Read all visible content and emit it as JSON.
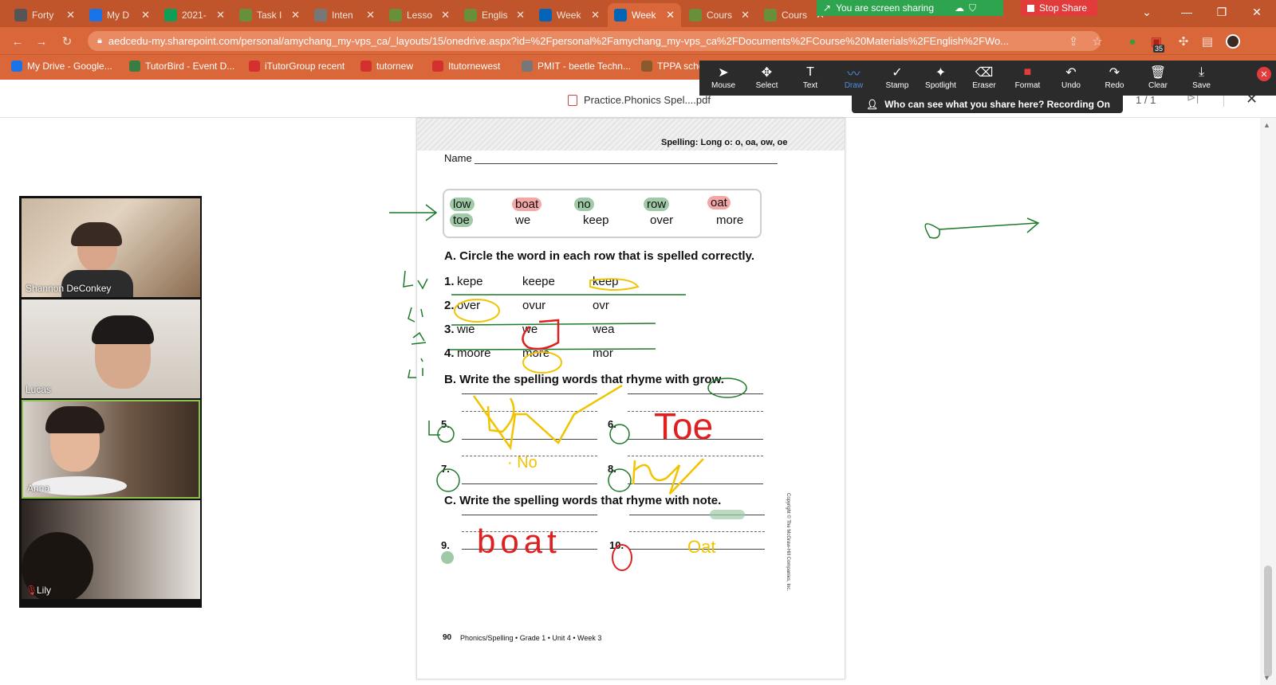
{
  "tabs": [
    {
      "title": "Forty",
      "icon": "gear-icon",
      "color": "#555555"
    },
    {
      "title": "My D",
      "icon": "drive-icon",
      "color": "#1a73e8"
    },
    {
      "title": "2021-",
      "icon": "sheets-icon",
      "color": "#0f9d58"
    },
    {
      "title": "Task I",
      "icon": "doc-icon",
      "color": "#6a8f3a"
    },
    {
      "title": "Inten",
      "icon": "globe-icon",
      "color": "#777777"
    },
    {
      "title": "Lesso",
      "icon": "doc-icon",
      "color": "#6a8f3a"
    },
    {
      "title": "Englis",
      "icon": "doc-icon",
      "color": "#6a8f3a"
    },
    {
      "title": "Week",
      "icon": "onedrive-icon",
      "color": "#0364b8"
    },
    {
      "title": "Week",
      "icon": "onedrive-icon",
      "color": "#0364b8"
    },
    {
      "title": "Cours",
      "icon": "doc-icon",
      "color": "#6a8f3a"
    },
    {
      "title": "Cours",
      "icon": "doc-icon",
      "color": "#6a8f3a"
    }
  ],
  "share": {
    "status": "You are screen sharing",
    "stop_label": "Stop Share"
  },
  "url": "aedcedu-my.sharepoint.com/personal/amychang_my-vps_ca/_layouts/15/onedrive.aspx?id=%2Fpersonal%2Famychang_my-vps_ca%2FDocuments%2FCourse%20Materials%2FEnglish%2FWo...",
  "extension_badge": "35",
  "bookmarks": [
    {
      "label": "My Drive - Google...",
      "icon": "drive-icon",
      "color": "#1a73e8"
    },
    {
      "label": "TutorBird - Event D...",
      "icon": "tutorbird-icon",
      "color": "#3a7d44"
    },
    {
      "label": "iTutorGroup recent",
      "icon": "itutor-icon",
      "color": "#d32f2f"
    },
    {
      "label": "tutornew",
      "icon": "itutor-icon",
      "color": "#d32f2f"
    },
    {
      "label": "Itutornewest",
      "icon": "itutor-icon",
      "color": "#d32f2f"
    },
    {
      "label": "PMIT - beetle Techn...",
      "icon": "globe-icon",
      "color": "#777777"
    },
    {
      "label": "TPPA scho",
      "icon": "crest-icon",
      "color": "#8a5a2b"
    }
  ],
  "toolbar": [
    {
      "label": "Mouse",
      "icon": "mouse-pointer-icon"
    },
    {
      "label": "Select",
      "icon": "move-icon"
    },
    {
      "label": "Text",
      "icon": "text-icon"
    },
    {
      "label": "Draw",
      "icon": "draw-icon"
    },
    {
      "label": "Stamp",
      "icon": "checkmark-icon"
    },
    {
      "label": "Spotlight",
      "icon": "spotlight-icon"
    },
    {
      "label": "Eraser",
      "icon": "eraser-icon"
    },
    {
      "label": "Format",
      "icon": "format-icon"
    },
    {
      "label": "Undo",
      "icon": "undo-icon"
    },
    {
      "label": "Redo",
      "icon": "redo-icon"
    },
    {
      "label": "Clear",
      "icon": "trash-icon"
    },
    {
      "label": "Save",
      "icon": "save-icon"
    }
  ],
  "who_can_see": "Who can see what you share here? Recording On",
  "pdf": {
    "filename": "Practice.Phonics Spel....pdf",
    "page_count": "1 / 1"
  },
  "worksheet": {
    "header": "Spelling: Long o: o, oa, ow, oe",
    "name_label": "Name",
    "word_box": {
      "row1": [
        "low",
        "boat",
        "no",
        "row",
        "oat"
      ],
      "row2": [
        "toe",
        "we",
        "keep",
        "over",
        "more"
      ]
    },
    "section_a": "A. Circle the word in each row that is spelled correctly.",
    "rows_a": [
      {
        "num": "1.",
        "words": [
          "kepe",
          "keepe",
          "keep"
        ]
      },
      {
        "num": "2.",
        "words": [
          "over",
          "ovur",
          "ovr"
        ]
      },
      {
        "num": "3.",
        "words": [
          "wie",
          "we",
          "wea"
        ]
      },
      {
        "num": "4.",
        "words": [
          "moore",
          "more",
          "mor"
        ]
      }
    ],
    "section_b": "B. Write the spelling words that rhyme with grow.",
    "section_c": "C. Write the spelling words that rhyme with note.",
    "blanks": [
      "5.",
      "6.",
      "7.",
      "8.",
      "9.",
      "10."
    ],
    "handwriting": {
      "no": "No",
      "toe": "Toe",
      "row": "row",
      "boat": "boat",
      "oat": "Oat"
    },
    "footer_page": "90",
    "footer_text": "Phonics/Spelling • Grade 1 • Unit 4 • Week 3",
    "copyright": "Copyright © The McGraw-Hill Companies, Inc."
  },
  "participants": [
    {
      "name": "Shannon DeConkey"
    },
    {
      "name": "Lucas"
    },
    {
      "name": "Anna"
    },
    {
      "name": "Lily"
    }
  ]
}
